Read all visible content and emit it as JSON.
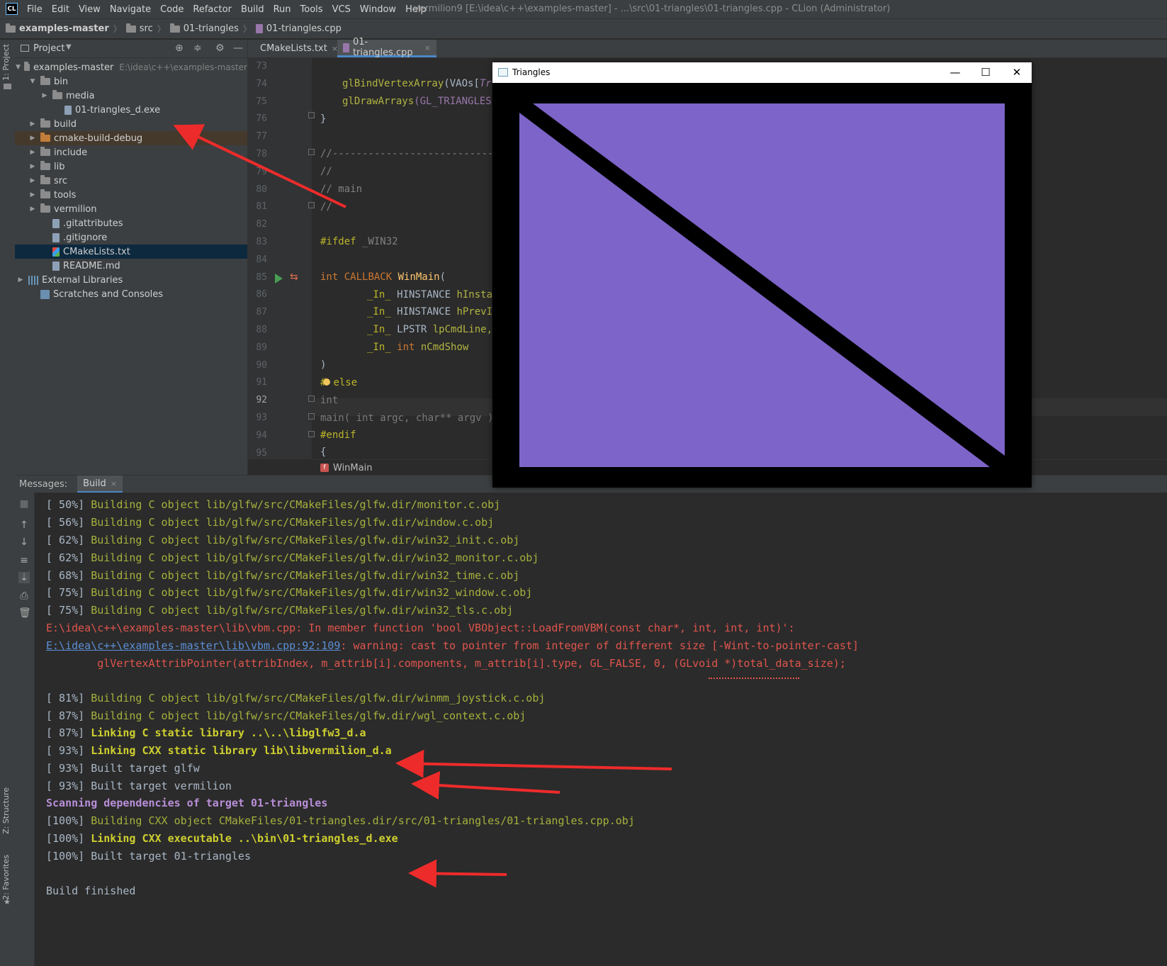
{
  "app": {
    "logo": "CL",
    "title": "vermilion9 [E:\\idea\\c++\\examples-master] - ...\\src\\01-triangles\\01-triangles.cpp - CLion (Administrator)",
    "menu": [
      "File",
      "Edit",
      "View",
      "Navigate",
      "Code",
      "Refactor",
      "Build",
      "Run",
      "Tools",
      "VCS",
      "Window",
      "Help"
    ]
  },
  "breadcrumb": [
    "examples-master",
    "src",
    "01-triangles",
    "01-triangles.cpp"
  ],
  "tool_strip": {
    "project": "1: Project",
    "structure": "Z: Structure",
    "favorites": "2: Favorites"
  },
  "project": {
    "title": "Project",
    "tree": [
      {
        "label": "examples-master",
        "path": "E:\\idea\\c++\\examples-master",
        "icon": "folder-icon"
      },
      {
        "label": "bin",
        "icon": "folder-icon"
      },
      {
        "label": "media",
        "icon": "folder-icon"
      },
      {
        "label": "01-triangles_d.exe",
        "icon": "file-icon"
      },
      {
        "label": "build",
        "icon": "folder-icon"
      },
      {
        "label": "cmake-build-debug",
        "icon": "folder-icon"
      },
      {
        "label": "include",
        "icon": "folder-icon"
      },
      {
        "label": "lib",
        "icon": "folder-icon"
      },
      {
        "label": "src",
        "icon": "folder-icon"
      },
      {
        "label": "tools",
        "icon": "folder-icon"
      },
      {
        "label": "vermilion",
        "icon": "folder-icon"
      },
      {
        "label": ".gitattributes",
        "icon": "file-icon"
      },
      {
        "label": ".gitignore",
        "icon": "file-icon"
      },
      {
        "label": "CMakeLists.txt",
        "icon": "cmake-icon"
      },
      {
        "label": "README.md",
        "icon": "file-icon"
      },
      {
        "label": "External Libraries",
        "icon": "library-icon"
      },
      {
        "label": "Scratches and Consoles",
        "icon": "scratch-icon"
      }
    ]
  },
  "editor": {
    "tabs": [
      {
        "label": "CMakeLists.txt",
        "close": "×"
      },
      {
        "label": "01-triangles.cpp",
        "close": "×"
      }
    ],
    "line_numbers": [
      "73",
      "74",
      "75",
      "76",
      "77",
      "78",
      "79",
      "80",
      "81",
      "82",
      "83",
      "84",
      "85",
      "86",
      "87",
      "88",
      "89",
      "90",
      "91",
      "92",
      "93",
      "94",
      "95"
    ],
    "lines": {
      "l74a": "glBindVertexArray",
      "l74b": "(VAOs[",
      "l74c": "Tr",
      "l75a": "glDrawArrays",
      "l75b": "(GL_TRIANGLES",
      "l76": "}",
      "l78": "//----------------------------",
      "l79": "//",
      "l80": "// main",
      "l81": "//",
      "l83a": "#ifdef",
      "l83b": " _WIN32",
      "l85a": "int",
      "l85b": " CALLBACK ",
      "l85c": "WinMain",
      "l85d": "(",
      "l86a": "_In_",
      "l86b": " HINSTANCE ",
      "l86c": "hInsta",
      "l87a": "_In_",
      "l87b": " HINSTANCE ",
      "l87c": "hPrevI",
      "l88a": "_In_",
      "l88b": " LPSTR ",
      "l88c": "lpCmdLine,",
      "l89a": "_In_",
      "l89b": " int ",
      "l89c": "nCmdShow",
      "l90": ")",
      "l91a": "#",
      "l91b": "else",
      "l92": "int",
      "l93": "main( int argc, char** argv )",
      "l94": "#endif",
      "l95": "{"
    },
    "breadcrumb_fn": "WinMain",
    "fn_badge": "f"
  },
  "messages": {
    "label": "Messages:",
    "tab": "Build",
    "tab_close": "×",
    "lines": [
      {
        "p": "[ 50%] ",
        "t": "Building C object lib/glfw/src/CMakeFiles/glfw.dir/monitor.c.obj"
      },
      {
        "p": "[ 56%] ",
        "t": "Building C object lib/glfw/src/CMakeFiles/glfw.dir/window.c.obj"
      },
      {
        "p": "[ 62%] ",
        "t": "Building C object lib/glfw/src/CMakeFiles/glfw.dir/win32_init.c.obj"
      },
      {
        "p": "[ 62%] ",
        "t": "Building C object lib/glfw/src/CMakeFiles/glfw.dir/win32_monitor.c.obj"
      },
      {
        "p": "[ 68%] ",
        "t": "Building C object lib/glfw/src/CMakeFiles/glfw.dir/win32_time.c.obj"
      },
      {
        "p": "[ 75%] ",
        "t": "Building C object lib/glfw/src/CMakeFiles/glfw.dir/win32_window.c.obj"
      },
      {
        "p": "[ 75%] ",
        "t": "Building C object lib/glfw/src/CMakeFiles/glfw.dir/win32_tls.c.obj"
      }
    ],
    "err1": "E:\\idea\\c++\\examples-master\\lib\\vbm.cpp: In member function 'bool VBObject::LoadFromVBM(const char*, int, int, int)':",
    "err2_link": "E:\\idea\\c++\\examples-master\\lib\\vbm.cpp:92:109",
    "err2_text": ": warning: cast to pointer from integer of different size [-Wint-to-pointer-cast]",
    "err3": "        glVertexAttribPointer(attribIndex, m_attrib[i].components, m_attrib[i].type, GL_FALSE, 0, (GLvoid *)total_data_size);",
    "lines2": [
      {
        "p": "[ 81%] ",
        "t": "Building C object lib/glfw/src/CMakeFiles/glfw.dir/winmm_joystick.c.obj"
      },
      {
        "p": "[ 87%] ",
        "t": "Building C object lib/glfw/src/CMakeFiles/glfw.dir/wgl_context.c.obj"
      },
      {
        "p": "[ 87%] ",
        "t": "Linking C static library ..\\..\\libglfw3_d.a"
      },
      {
        "p": "[ 93%] ",
        "t": "Linking CXX static library lib\\libvermilion_d.a"
      },
      {
        "p": "[ 93%] ",
        "t": "Built target glfw"
      },
      {
        "p": "[ 93%] ",
        "t": "Built target vermilion"
      }
    ],
    "scanning": "Scanning dependencies of target 01-triangles",
    "lines3": [
      {
        "p": "[100%] ",
        "t": "Building CXX object CMakeFiles/01-triangles.dir/src/01-triangles/01-triangles.cpp.obj"
      },
      {
        "p": "[100%] ",
        "t": "Linking CXX executable ..\\bin\\01-triangles_d.exe"
      },
      {
        "p": "[100%] ",
        "t": "Built target 01-triangles"
      }
    ],
    "finished": "Build finished"
  },
  "gl_window": {
    "title": "Triangles",
    "minimize": "—",
    "maximize": "☐",
    "close": "✕",
    "fill_color": "#7d64c8",
    "background": "#000000"
  },
  "colors": {
    "annotation_arrow": "#ee2b2b",
    "console_green": "#a6b13c",
    "console_red": "#e0554d",
    "console_purple": "#b98fd9"
  }
}
